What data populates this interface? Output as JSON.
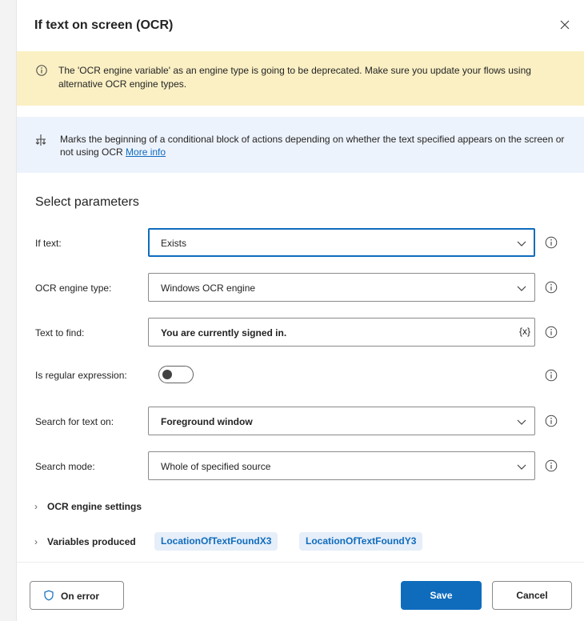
{
  "dialog": {
    "title": "If text on screen (OCR)"
  },
  "warning": {
    "text": "The 'OCR engine variable' as an engine type is going to be deprecated.  Make sure you update your flows using alternative OCR engine types."
  },
  "info": {
    "text": "Marks the beginning of a conditional block of actions depending on whether the text specified appears on the screen or not using OCR ",
    "link": "More info"
  },
  "parameters": {
    "section_title": "Select parameters",
    "if_text": {
      "label": "If text:",
      "value": "Exists"
    },
    "ocr_engine_type": {
      "label": "OCR engine type:",
      "value": "Windows OCR engine"
    },
    "text_to_find": {
      "label": "Text to find:",
      "value": "You are currently signed in.",
      "var_button": "{x}"
    },
    "is_regex": {
      "label": "Is regular expression:",
      "enabled": false
    },
    "search_for_text_on": {
      "label": "Search for text on:",
      "value": "Foreground window"
    },
    "search_mode": {
      "label": "Search mode:",
      "value": "Whole of specified source"
    }
  },
  "expanders": {
    "ocr_settings": "OCR engine settings",
    "variables_produced": "Variables produced",
    "variables": [
      "LocationOfTextFoundX3",
      "LocationOfTextFoundY3"
    ]
  },
  "footer": {
    "on_error": "On error",
    "save": "Save",
    "cancel": "Cancel"
  },
  "colors": {
    "accent": "#0f6cbd",
    "warning_bg": "#fbf0c4",
    "info_bg": "#edf3fc"
  }
}
